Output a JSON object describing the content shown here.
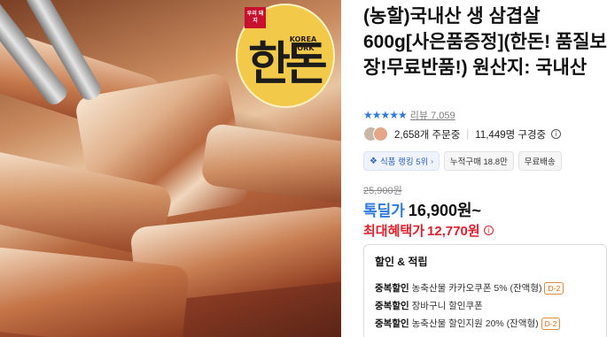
{
  "photo": {
    "logo_badge": "우리 돼지",
    "logo_text": "한돈",
    "logo_subtext": "KOREA PORK"
  },
  "product": {
    "title": "(농할)국내산 생 삼겹살 600g[사은품증정](한돈! 품질보장!무료반품!) 원산지: 국내산"
  },
  "rating": {
    "stars": "★★★★★",
    "review_label": "리뷰 7,059"
  },
  "orders": {
    "ordering": "2,658개 주문중",
    "buying": "11,449명 구경중"
  },
  "tags": {
    "rank": "식품 랭킹 5위",
    "cumulative": "누적구매 18.8만",
    "shipping": "무료배송"
  },
  "price": {
    "original": "25,900원",
    "label": "톡딜가",
    "current": "16,900원~",
    "max_label": "최대혜택가",
    "max_price": "12,770원"
  },
  "discounts": {
    "title": "할인 & 적립",
    "items": [
      {
        "label": "중복할인",
        "text": "농축산물 카카오쿠폰 5% (잔액형)",
        "badge": "D-2"
      },
      {
        "label": "중복할인",
        "text": "장바구니 할인쿠폰",
        "badge": ""
      },
      {
        "label": "중복할인",
        "text": "농축산물 할인지원 20% (잔액형)",
        "badge": "D-2"
      }
    ]
  },
  "colors": {
    "accent_blue": "#2f7ae0",
    "sale_red": "#e21f2a",
    "badge_orange": "#e06a12"
  }
}
